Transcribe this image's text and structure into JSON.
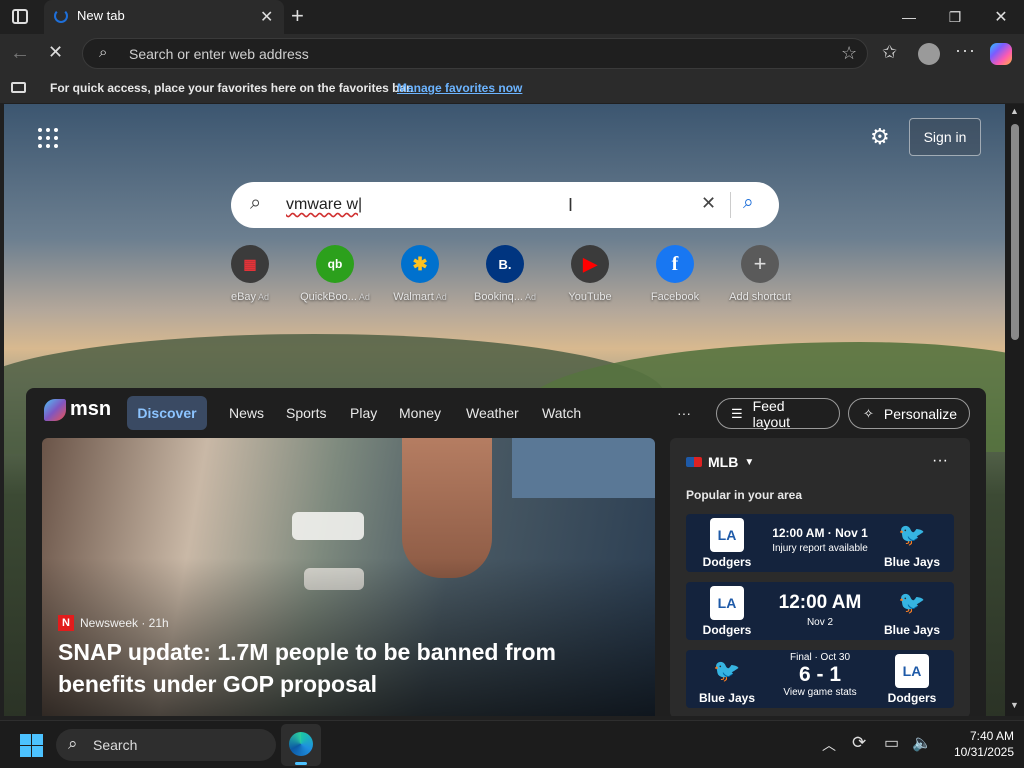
{
  "browser": {
    "tab_title": "New tab",
    "address_placeholder": "Search or enter web address"
  },
  "favorites_bar": {
    "message": "For quick access, place your favorites here on the favorites bar.",
    "link": "Manage favorites now"
  },
  "newtab": {
    "sign_in": "Sign in",
    "search_value": "vmware w",
    "shortcuts": [
      {
        "label": "eBay",
        "ad": "Ad",
        "color": "#2b2b2b",
        "glyph": "▦"
      },
      {
        "label": "QuickBoo...",
        "ad": "Ad",
        "color": "#2ca01c",
        "glyph": "qb"
      },
      {
        "label": "Walmart",
        "ad": "Ad",
        "color": "#0071ce",
        "glyph": "✱"
      },
      {
        "label": "Bookinq...",
        "ad": "Ad",
        "color": "#003580",
        "glyph": "B."
      },
      {
        "label": "YouTube",
        "ad": "",
        "color": "#ff0000",
        "glyph": "▶"
      },
      {
        "label": "Facebook",
        "ad": "",
        "color": "#1877f2",
        "glyph": "f"
      },
      {
        "label": "Add shortcut",
        "ad": "",
        "color": "#5a5a5a",
        "glyph": "+"
      }
    ]
  },
  "msn": {
    "logo": "msn",
    "nav": [
      "Discover",
      "News",
      "Sports",
      "Play",
      "Money",
      "Weather",
      "Watch"
    ],
    "more": "···",
    "feed_layout": "Feed layout",
    "personalize": "Personalize",
    "hero": {
      "source": "Newsweek · 21h",
      "headline": "SNAP update: 1.7M people to be banned from benefits under GOP proposal"
    },
    "widget": {
      "title": "MLB",
      "subtitle": "Popular in your area",
      "games": [
        {
          "left": "Dodgers",
          "right": "Blue Jays",
          "line1": "12:00 AM · Nov 1",
          "line2": "Injury report available"
        },
        {
          "left": "Dodgers",
          "right": "Blue Jays",
          "line1": "12:00 AM",
          "line2": "Nov 2"
        },
        {
          "left": "Blue Jays",
          "right": "Dodgers",
          "line0": "Final · Oct 30",
          "line1": "6 - 1",
          "line2": "View game stats"
        }
      ]
    }
  },
  "taskbar": {
    "search": "Search",
    "time": "7:40 AM",
    "date": "10/31/2025"
  },
  "colors": {
    "accent_link": "#6cb4ff",
    "discover_pill": "#3a4a63",
    "msn_red": "#e21c1c"
  }
}
